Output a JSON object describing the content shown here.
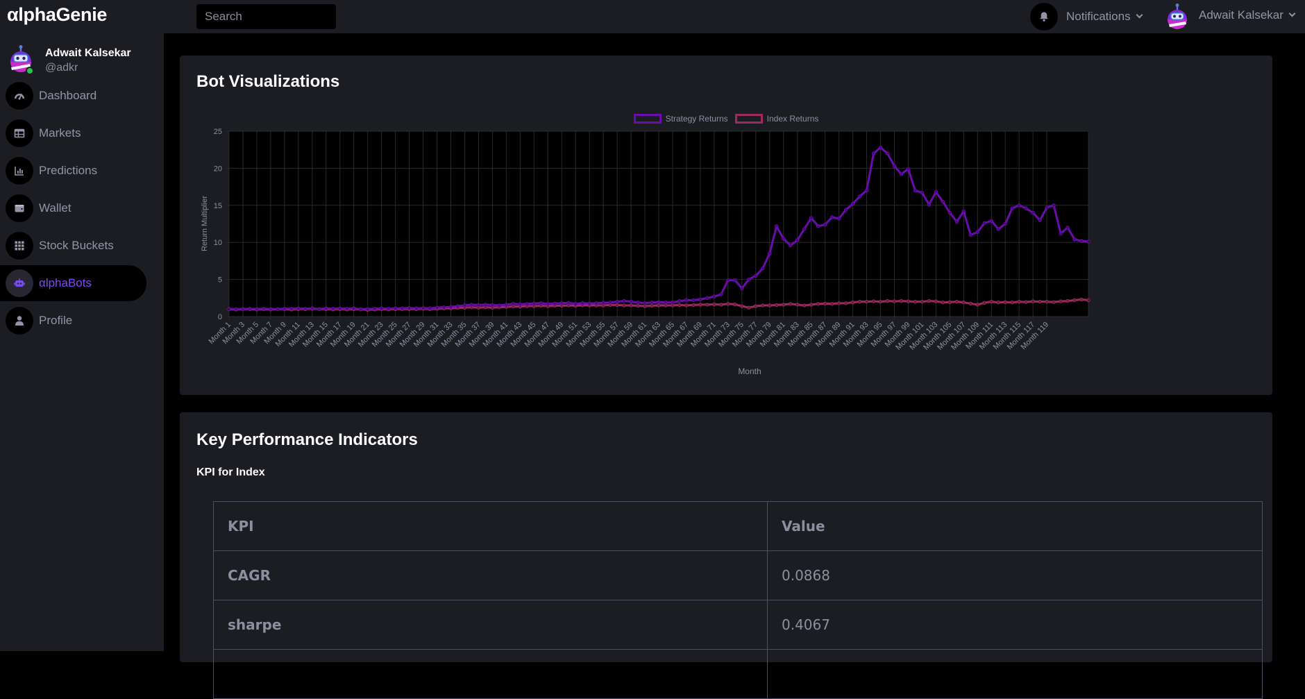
{
  "app": {
    "logo": "αlphaGenie"
  },
  "topbar": {
    "search_placeholder": "Search",
    "notifications_label": "Notifications",
    "user_name": "Adwait Kalsekar"
  },
  "profile": {
    "name": "Adwait Kalsekar",
    "handle": "@adkr"
  },
  "sidebar": {
    "items": [
      {
        "label": "Dashboard",
        "icon": "dashboard-icon"
      },
      {
        "label": "Markets",
        "icon": "table-icon"
      },
      {
        "label": "Predictions",
        "icon": "bar-chart-icon"
      },
      {
        "label": "Wallet",
        "icon": "wallet-icon"
      },
      {
        "label": "Stock Buckets",
        "icon": "grid-icon"
      },
      {
        "label": "αlphaBots",
        "icon": "robot-icon",
        "active": true
      },
      {
        "label": "Profile",
        "icon": "person-icon"
      }
    ]
  },
  "viz": {
    "title": "Bot Visualizations"
  },
  "chart_data": {
    "type": "line",
    "xlabel": "Month",
    "ylabel": "Return Multiplier",
    "ylim": [
      0,
      25
    ],
    "yticks": [
      0,
      5,
      10,
      15,
      20,
      25
    ],
    "x_tick_labels": [
      "Month 1",
      "Month 3",
      "Month 5",
      "Month 7",
      "Month 9",
      "Month 11",
      "Month 13",
      "Month 15",
      "Month 17",
      "Month 19",
      "Month 21",
      "Month 23",
      "Month 25",
      "Month 27",
      "Month 29",
      "Month 31",
      "Month 33",
      "Month 35",
      "Month 37",
      "Month 39",
      "Month 41",
      "Month 43",
      "Month 45",
      "Month 47",
      "Month 49",
      "Month 51",
      "Month 53",
      "Month 55",
      "Month 57",
      "Month 59",
      "Month 61",
      "Month 63",
      "Month 65",
      "Month 67",
      "Month 69",
      "Month 71",
      "Month 73",
      "Month 75",
      "Month 77",
      "Month 79",
      "Month 81",
      "Month 83",
      "Month 85",
      "Month 87",
      "Month 89",
      "Month 91",
      "Month 93",
      "Month 95",
      "Month 97",
      "Month 99",
      "Month 101",
      "Month 103",
      "Month 105",
      "Month 107",
      "Month 109",
      "Month 111",
      "Month 113",
      "Month 115",
      "Month 117",
      "Month 119"
    ],
    "grid": true,
    "legend_position": "top",
    "series": [
      {
        "name": "Strategy Returns",
        "color": "#6a0dad",
        "values": [
          1.0,
          1.0,
          1.0,
          1.05,
          1.0,
          1.05,
          1.0,
          1.0,
          1.05,
          1.05,
          1.1,
          1.05,
          1.1,
          1.0,
          1.1,
          1.05,
          1.1,
          1.05,
          1.1,
          1.0,
          1.0,
          1.05,
          1.1,
          1.05,
          1.1,
          1.1,
          1.15,
          1.1,
          1.15,
          1.1,
          1.2,
          1.25,
          1.3,
          1.4,
          1.5,
          1.6,
          1.55,
          1.6,
          1.55,
          1.5,
          1.6,
          1.7,
          1.65,
          1.7,
          1.75,
          1.8,
          1.7,
          1.75,
          1.8,
          1.85,
          1.7,
          1.8,
          1.75,
          1.8,
          1.85,
          1.9,
          2.0,
          2.1,
          2.0,
          1.9,
          1.8,
          1.9,
          1.95,
          1.9,
          1.9,
          2.1,
          2.2,
          2.2,
          2.3,
          2.5,
          2.7,
          3.0,
          4.9,
          4.9,
          3.8,
          5.0,
          5.5,
          6.5,
          8.5,
          12.2,
          10.5,
          9.6,
          10.3,
          11.8,
          13.3,
          12.2,
          12.4,
          13.4,
          13.2,
          14.4,
          15.2,
          16.2,
          17.0,
          22.0,
          22.8,
          22.0,
          20.3,
          19.2,
          19.9,
          17.0,
          16.7,
          15.1,
          16.8,
          15.5,
          14.0,
          12.8,
          14.2,
          11.0,
          11.4,
          12.6,
          12.9,
          11.8,
          12.5,
          14.6,
          15.0,
          14.6,
          14.0,
          13.0,
          14.7,
          15.0,
          11.2,
          12.0,
          10.4,
          10.2,
          10.1
        ]
      },
      {
        "name": "Index Returns",
        "color": "#9e2a5e",
        "values": [
          1.0,
          0.95,
          1.0,
          1.0,
          0.95,
          1.0,
          0.95,
          1.0,
          1.0,
          0.95,
          1.0,
          1.0,
          1.05,
          1.0,
          1.0,
          0.95,
          1.0,
          0.95,
          1.0,
          0.95,
          0.9,
          0.95,
          1.0,
          0.95,
          1.0,
          1.0,
          1.0,
          1.0,
          1.05,
          1.0,
          1.05,
          1.1,
          1.1,
          1.15,
          1.2,
          1.25,
          1.2,
          1.25,
          1.2,
          1.25,
          1.3,
          1.35,
          1.35,
          1.4,
          1.4,
          1.45,
          1.4,
          1.45,
          1.45,
          1.5,
          1.45,
          1.5,
          1.5,
          1.5,
          1.5,
          1.55,
          1.55,
          1.5,
          1.5,
          1.45,
          1.4,
          1.45,
          1.5,
          1.5,
          1.5,
          1.55,
          1.5,
          1.55,
          1.6,
          1.6,
          1.65,
          1.6,
          1.7,
          1.65,
          1.4,
          1.2,
          1.4,
          1.5,
          1.5,
          1.55,
          1.6,
          1.7,
          1.6,
          1.5,
          1.6,
          1.7,
          1.75,
          1.7,
          1.8,
          1.8,
          1.9,
          2.0,
          2.0,
          2.05,
          2.0,
          2.1,
          2.05,
          2.1,
          2.05,
          2.0,
          2.0,
          2.1,
          2.05,
          1.9,
          1.95,
          2.0,
          1.9,
          1.75,
          1.6,
          1.85,
          2.0,
          1.9,
          1.95,
          1.9,
          2.0,
          1.95,
          2.05,
          2.0,
          2.0,
          1.95,
          2.05,
          2.1,
          2.2,
          2.3,
          2.2
        ]
      }
    ]
  },
  "kpi": {
    "title": "Key Performance Indicators",
    "subtitle": "KPI for Index",
    "headers": [
      "KPI",
      "Value"
    ],
    "rows": [
      {
        "kpi": "CAGR",
        "value": "0.0868"
      },
      {
        "kpi": "sharpe",
        "value": "0.4067"
      },
      {
        "kpi": "",
        "value": ""
      }
    ]
  }
}
